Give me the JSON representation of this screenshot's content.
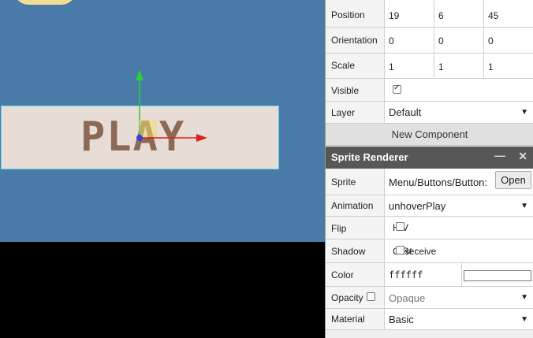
{
  "viewport": {
    "button_text": "PLAY",
    "colors": {
      "sky": "#4a7aa8",
      "button_bg": "#e8dcd6",
      "button_border": "#5ed6e0",
      "text": "#8a6a55"
    }
  },
  "transform": {
    "position": {
      "label": "Position",
      "x": "19",
      "y": "6",
      "z": "45"
    },
    "orientation": {
      "label": "Orientation",
      "x": "0",
      "y": "0",
      "z": "0"
    },
    "scale": {
      "label": "Scale",
      "x": "1",
      "y": "1",
      "z": "1"
    },
    "visible": {
      "label": "Visible",
      "checked": true
    },
    "layer": {
      "label": "Layer",
      "value": "Default"
    }
  },
  "new_component_label": "New Component",
  "sprite_renderer": {
    "title": "Sprite Renderer",
    "minimize_glyph": "—",
    "close_glyph": "✕",
    "sprite": {
      "label": "Sprite",
      "value": "Menu/Buttons/Button:",
      "open_label": "Open"
    },
    "animation": {
      "label": "Animation",
      "value": "unhoverPlay"
    },
    "flip": {
      "label": "Flip",
      "h_label": "H",
      "v_label": "V"
    },
    "shadow": {
      "label": "Shadow",
      "cast_label": "Cast",
      "receive_label": "Receive"
    },
    "color": {
      "label": "Color",
      "value": "ffffff"
    },
    "opacity": {
      "label": "Opacity",
      "value": "Opaque"
    },
    "material": {
      "label": "Material",
      "value": "Basic"
    }
  },
  "dropdown_arrow": "▼"
}
